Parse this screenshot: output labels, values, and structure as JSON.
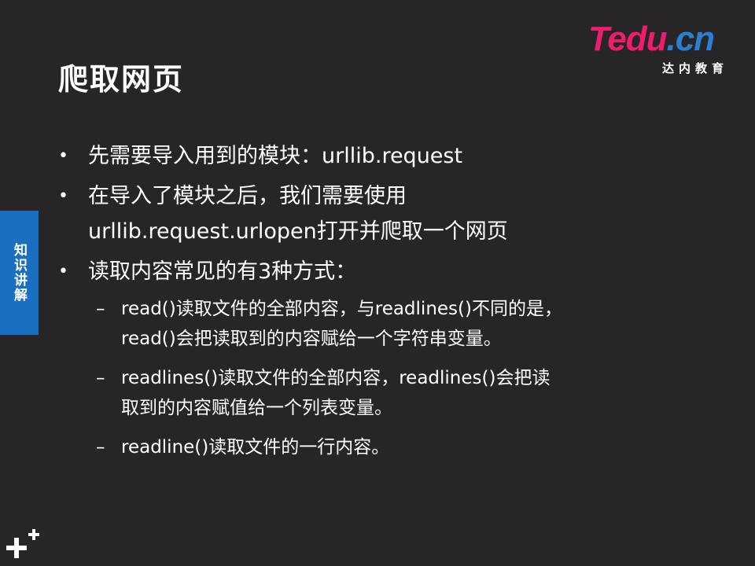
{
  "slide": {
    "title": "爬取网页"
  },
  "logo": {
    "brand_main": "Tedu",
    "brand_dot": ".cn",
    "brand_sub": "达内教育"
  },
  "side_tab": {
    "label": "知识讲解"
  },
  "bullets": [
    {
      "marker": "•",
      "lines": [
        "先需要导入用到的模块：urllib.request"
      ]
    },
    {
      "marker": "•",
      "lines": [
        "在导入了模块之后，我们需要使用",
        "urllib.request.urlopen打开并爬取一个网页"
      ]
    },
    {
      "marker": "•",
      "lines": [
        "读取内容常见的有3种方式："
      ]
    }
  ],
  "sub_bullets": [
    {
      "marker": "–",
      "lines": [
        "read()读取文件的全部内容，与readlines()不同的是，",
        "read()会把读取到的内容赋给一个字符串变量。"
      ]
    },
    {
      "marker": "–",
      "lines": [
        "readlines()读取文件的全部内容，readlines()会把读",
        "取到的内容赋值给一个列表变量。"
      ]
    },
    {
      "marker": "–",
      "lines": [
        "readline()读取文件的一行内容。"
      ]
    }
  ],
  "colors": {
    "background": "#282526",
    "side_tab": "#1a6fc0",
    "logo_pink": "#ec1c6e",
    "logo_blue": "#2b7fd0"
  },
  "icons": {
    "corner": "plus-icon"
  }
}
